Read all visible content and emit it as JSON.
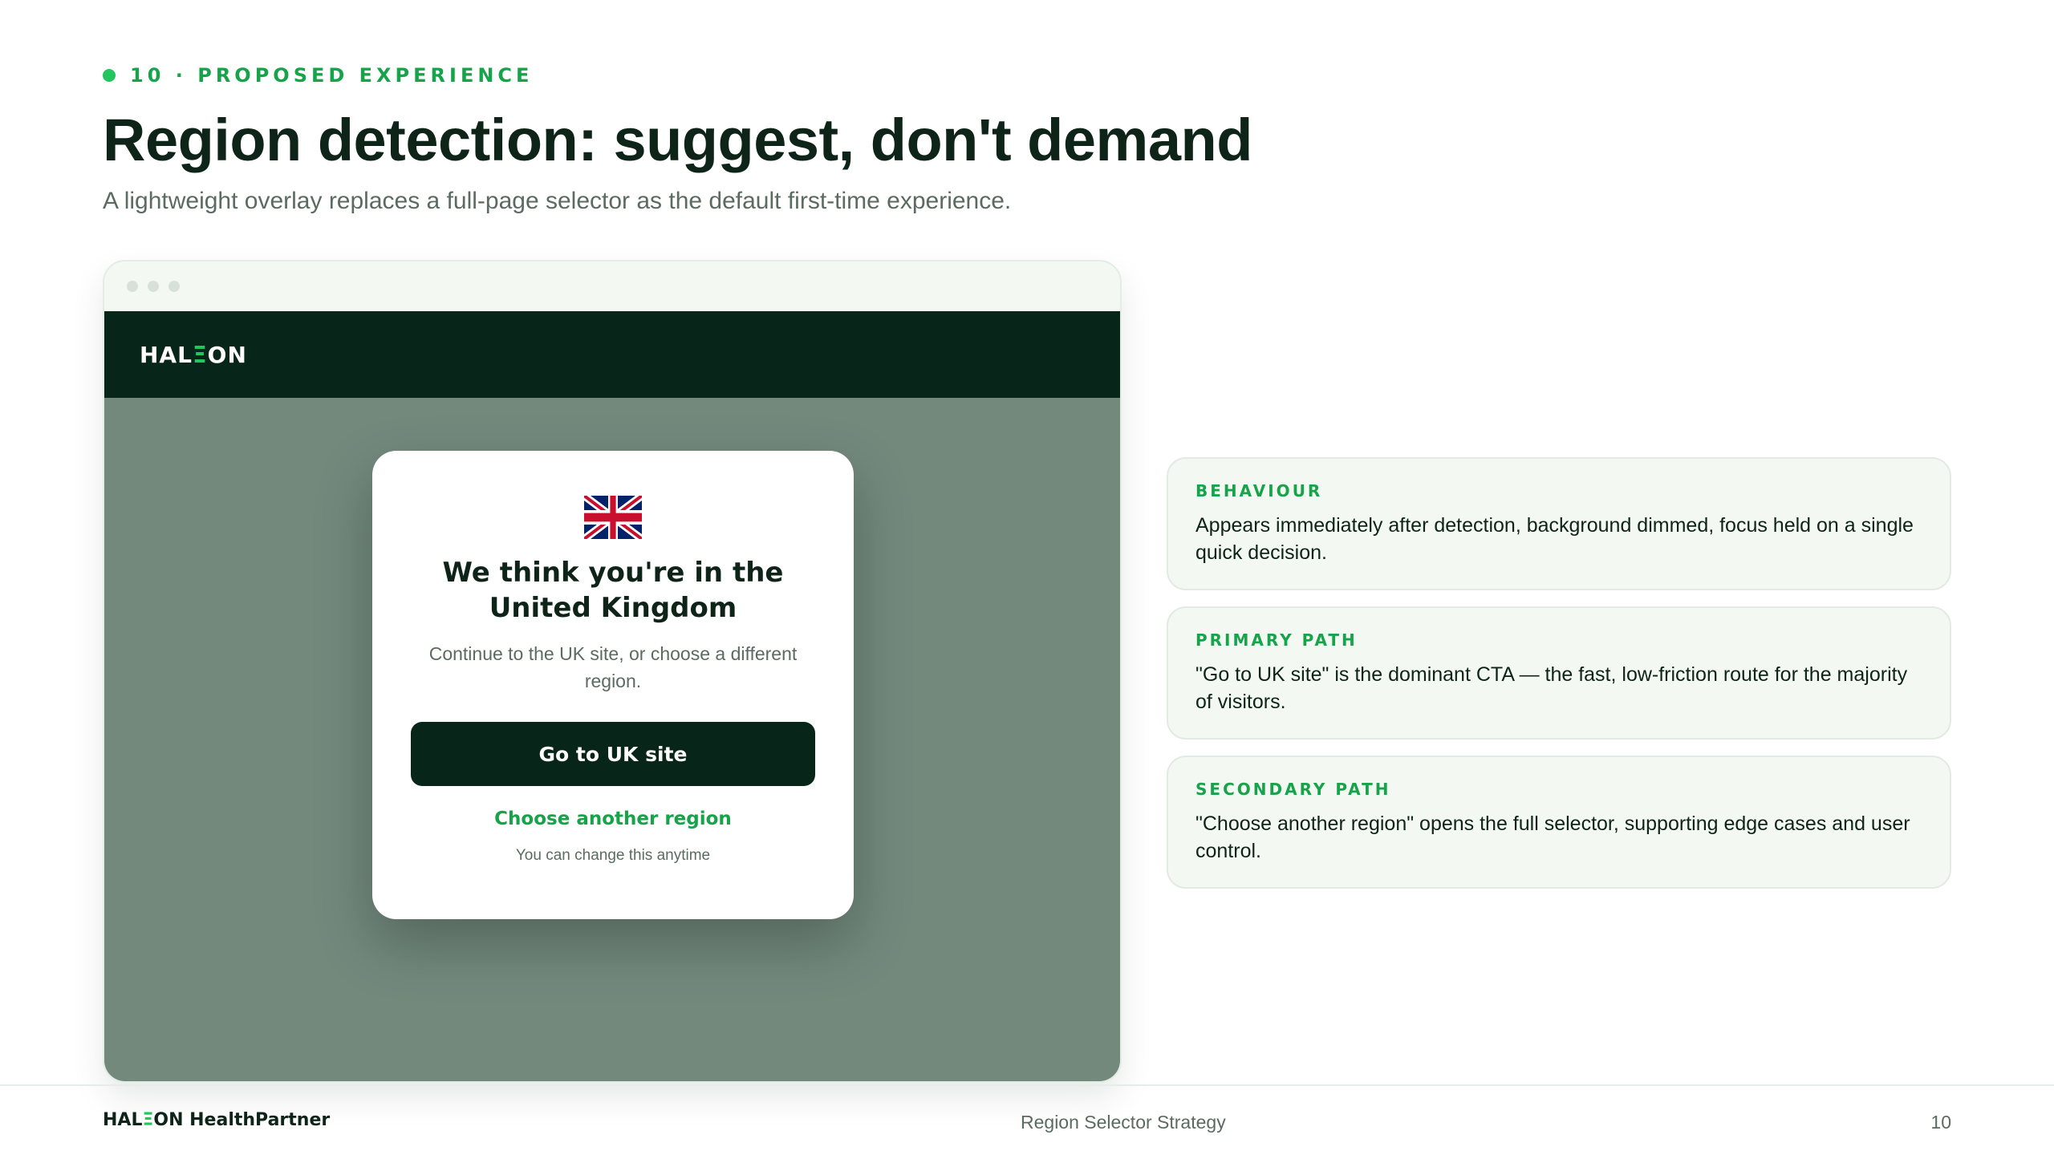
{
  "eyebrow": {
    "text": "10 · PROPOSED EXPERIENCE"
  },
  "header": {
    "title": "Region detection: suggest, don't demand",
    "subtitle": "A lightweight overlay replaces a full-page selector as the default first-time experience."
  },
  "mockup": {
    "logo_prefix": "HAL",
    "logo_mark": "Ξ",
    "logo_suffix": "ON",
    "modal": {
      "flag_icon": "uk-flag-icon",
      "title": "We think you're in the United Kingdom",
      "body": "Continue to the UK site, or choose a different region.",
      "primary_label": "Go to UK site",
      "secondary_label": "Choose another region",
      "footnote": "You can change this anytime"
    }
  },
  "cards": [
    {
      "label": "BEHAVIOUR",
      "text": "Appears immediately after detection, background dimmed, focus held on a single quick decision."
    },
    {
      "label": "PRIMARY PATH",
      "text": "\"Go to UK site\" is the dominant CTA — the fast, low-friction route for the majority of visitors."
    },
    {
      "label": "SECONDARY PATH",
      "text": "\"Choose another region\" opens the full selector, supporting edge cases and user control."
    }
  ],
  "footer": {
    "brand_prefix": "HAL",
    "brand_mark": "Ξ",
    "brand_suffix": "ON HealthPartner",
    "center": "Region Selector Strategy",
    "page": "10"
  },
  "colors": {
    "accent": "#16a34a",
    "dark": "#072518",
    "backdrop": "#72897c"
  }
}
